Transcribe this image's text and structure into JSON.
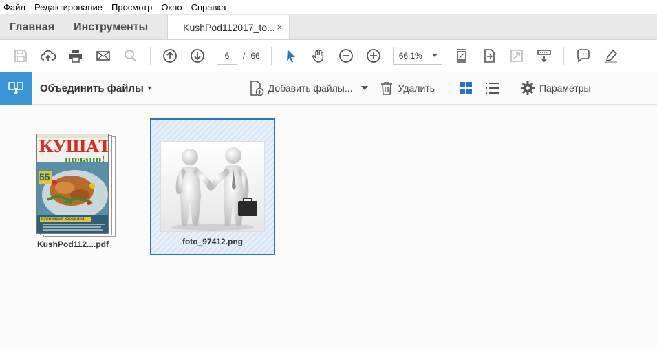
{
  "menu": [
    "Файл",
    "Редактирование",
    "Просмотр",
    "Окно",
    "Справка"
  ],
  "tabs": {
    "home": "Главная",
    "tools": "Инструменты",
    "document": "KushPod112017_to...",
    "close": "×"
  },
  "toolbar": {
    "page_current": "6",
    "page_separator": "/",
    "page_total": "66",
    "zoom": "66,1%"
  },
  "combine": {
    "title": "Объединить файлы",
    "add_files": "Добавить файлы...",
    "delete": "Удалить",
    "parameters": "Параметры"
  },
  "files": [
    {
      "name": "KushPod112....pdf",
      "cover_title": "КУШАТЬ",
      "cover_subtitle": "подано!",
      "cover_badge": "55",
      "cover_footer": "Кулинария изобилия"
    },
    {
      "name": "foto_97412.png"
    }
  ],
  "colors": {
    "accent": "#3a94d8",
    "selection": "#2a73c9",
    "grid_icon": "#2a73c9"
  }
}
